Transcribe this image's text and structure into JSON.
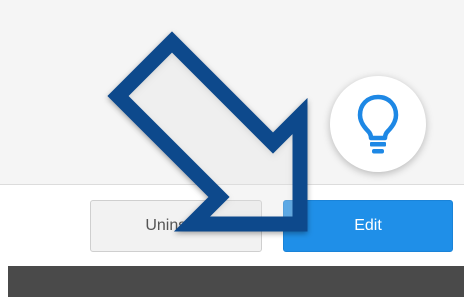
{
  "buttons": {
    "uninstall_label": "Uninstall",
    "edit_label": "Edit"
  },
  "icons": {
    "tip": "lightbulb-icon",
    "pointer": "arrow-down-right-icon"
  },
  "colors": {
    "edit_button": "#1f8fe8",
    "arrow_outline": "#0b4a8c",
    "lightbulb": "#1e88e5",
    "bottom_bar": "#4a4a4a"
  }
}
